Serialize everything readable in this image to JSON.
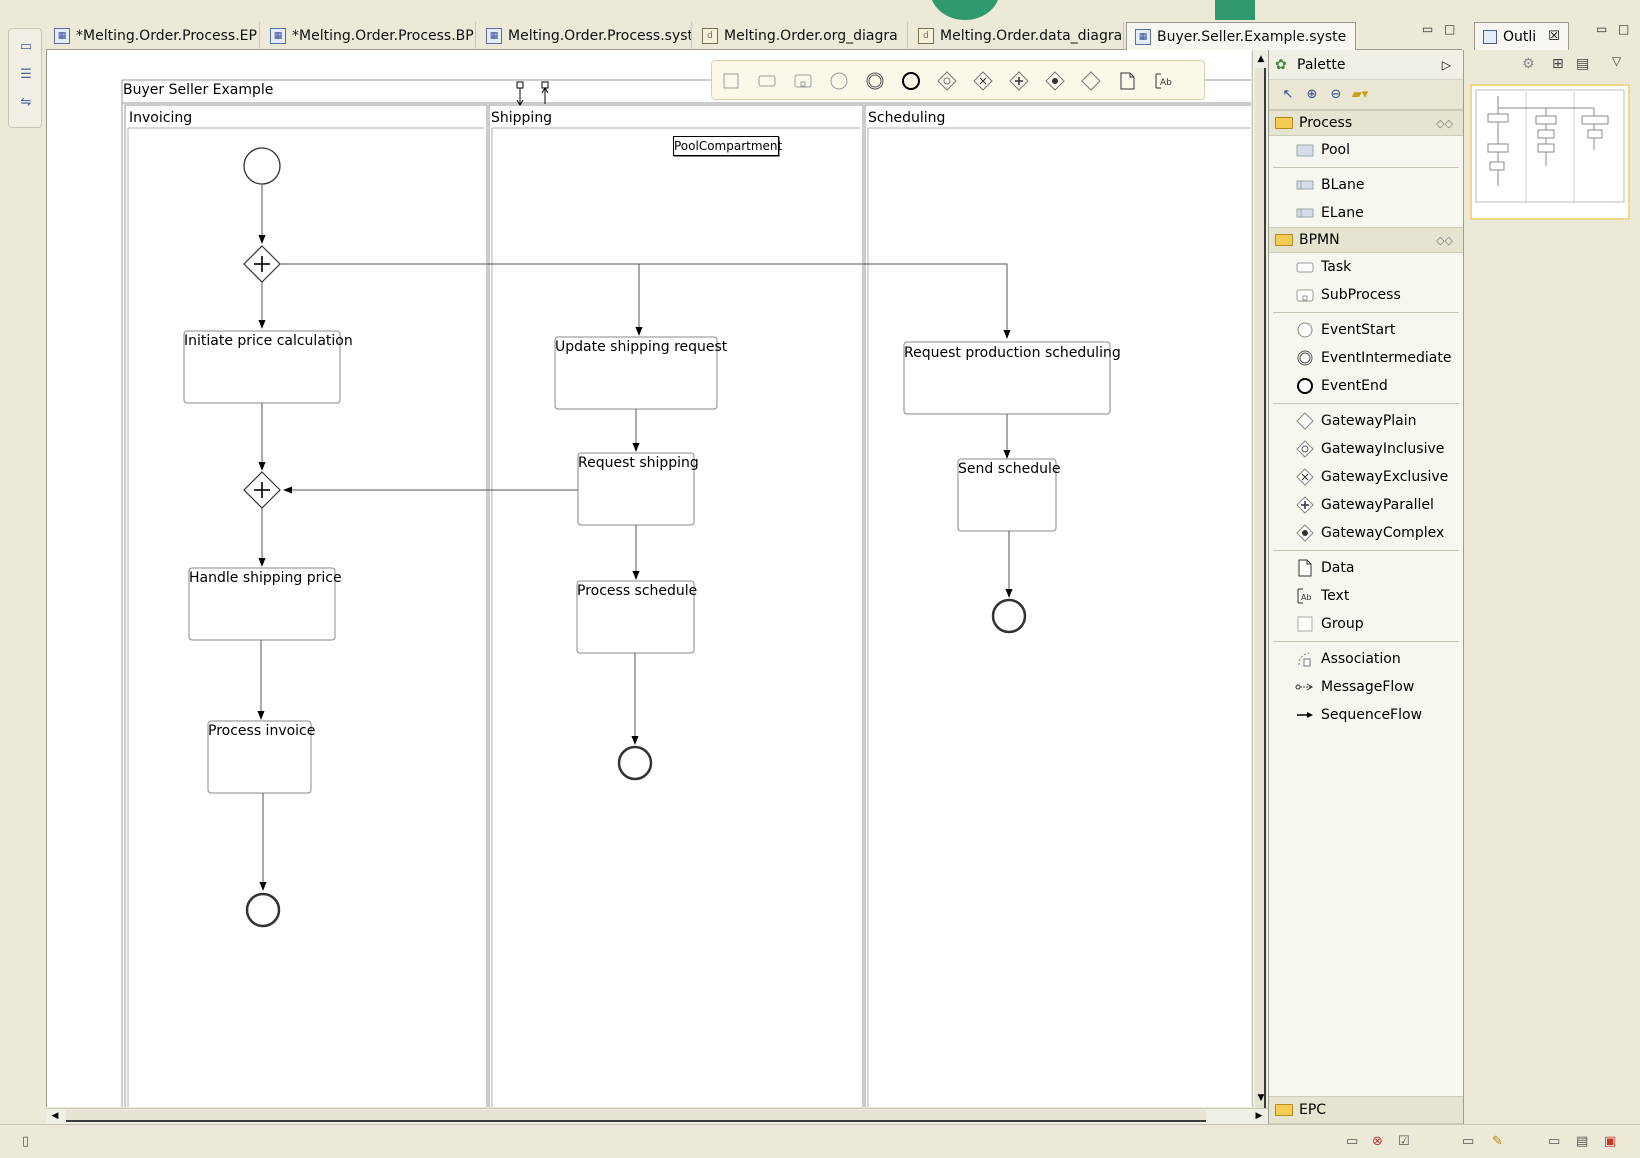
{
  "editor_tabs": [
    {
      "label": "*Melting.Order.Process.EP",
      "icon": "process-diagram-icon"
    },
    {
      "label": "*Melting.Order.Process.BP",
      "icon": "process-diagram-icon"
    },
    {
      "label": "Melting.Order.Process.syst",
      "icon": "process-diagram-icon"
    },
    {
      "label": "Melting.Order.org_diagra",
      "icon": "document-icon"
    },
    {
      "label": "Melting.Order.data_diagra",
      "icon": "document-icon"
    },
    {
      "label": "Buyer.Seller.Example.syste",
      "icon": "process-diagram-icon",
      "active": true,
      "close": "☒"
    }
  ],
  "diagram": {
    "pool_title": "Buyer Seller Example",
    "pool_compartment_label": "PoolCompartment",
    "lanes": [
      "Invoicing",
      "Shipping",
      "Scheduling"
    ],
    "tasks": {
      "initiate_price": "Initiate price calculation",
      "handle_shipping_price": "Handle shipping price",
      "process_invoice": "Process invoice",
      "update_shipping": "Update shipping request",
      "request_shipping": "Request shipping",
      "process_schedule": "Process schedule",
      "request_production": "Request production scheduling",
      "send_schedule": "Send schedule"
    }
  },
  "palette": {
    "title": "Palette",
    "drawers": {
      "process": {
        "label": "Process",
        "items": [
          "Pool",
          "BLane",
          "ELane"
        ]
      },
      "bpmn": {
        "label": "BPMN",
        "items": [
          "Task",
          "SubProcess",
          "EventStart",
          "EventIntermediate",
          "EventEnd",
          "GatewayPlain",
          "GatewayInclusive",
          "GatewayExclusive",
          "GatewayParallel",
          "GatewayComplex",
          "Data",
          "Text",
          "Group",
          "Association",
          "MessageFlow",
          "SequenceFlow"
        ]
      },
      "epc": {
        "label": "EPC"
      }
    }
  },
  "outline": {
    "tab_label": "Outli",
    "close": "☒"
  }
}
